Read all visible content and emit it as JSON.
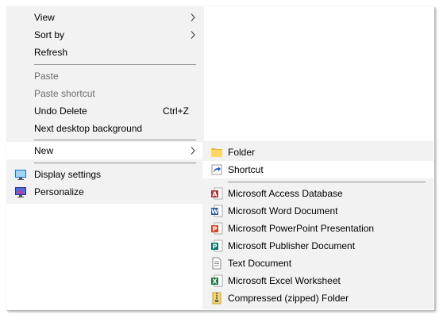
{
  "main_menu": {
    "items": [
      {
        "label": "View",
        "has_submenu": true
      },
      {
        "label": "Sort by",
        "has_submenu": true
      },
      {
        "label": "Refresh"
      },
      {
        "label": "Paste",
        "disabled": true
      },
      {
        "label": "Paste shortcut",
        "disabled": true
      },
      {
        "label": "Undo Delete",
        "shortcut": "Ctrl+Z"
      },
      {
        "label": "Next desktop background"
      },
      {
        "label": "New",
        "has_submenu": true,
        "highlighted": true
      },
      {
        "label": "Display settings",
        "icon": "display-settings-icon"
      },
      {
        "label": "Personalize",
        "icon": "personalize-icon"
      }
    ]
  },
  "new_submenu": {
    "items": [
      {
        "label": "Folder",
        "icon": "folder-icon"
      },
      {
        "label": "Shortcut",
        "icon": "shortcut-icon",
        "highlighted": true
      },
      {
        "label": "Microsoft Access Database",
        "icon": "access-database-icon"
      },
      {
        "label": "Microsoft Word Document",
        "icon": "word-document-icon"
      },
      {
        "label": "Microsoft PowerPoint Presentation",
        "icon": "powerpoint-presentation-icon"
      },
      {
        "label": "Microsoft Publisher Document",
        "icon": "publisher-document-icon"
      },
      {
        "label": "Text Document",
        "icon": "text-document-icon"
      },
      {
        "label": "Microsoft Excel Worksheet",
        "icon": "excel-worksheet-icon"
      },
      {
        "label": "Compressed (zipped) Folder",
        "icon": "zipped-folder-icon"
      }
    ]
  },
  "colors": {
    "menu_background": "#f2f2f2",
    "hover_background": "#ffffff",
    "disabled_text": "#6d6d6d",
    "access": "#a4373a",
    "word": "#2b579a",
    "powerpoint": "#d24726",
    "publisher": "#077568",
    "excel": "#217346",
    "folder": "#ffd767"
  }
}
